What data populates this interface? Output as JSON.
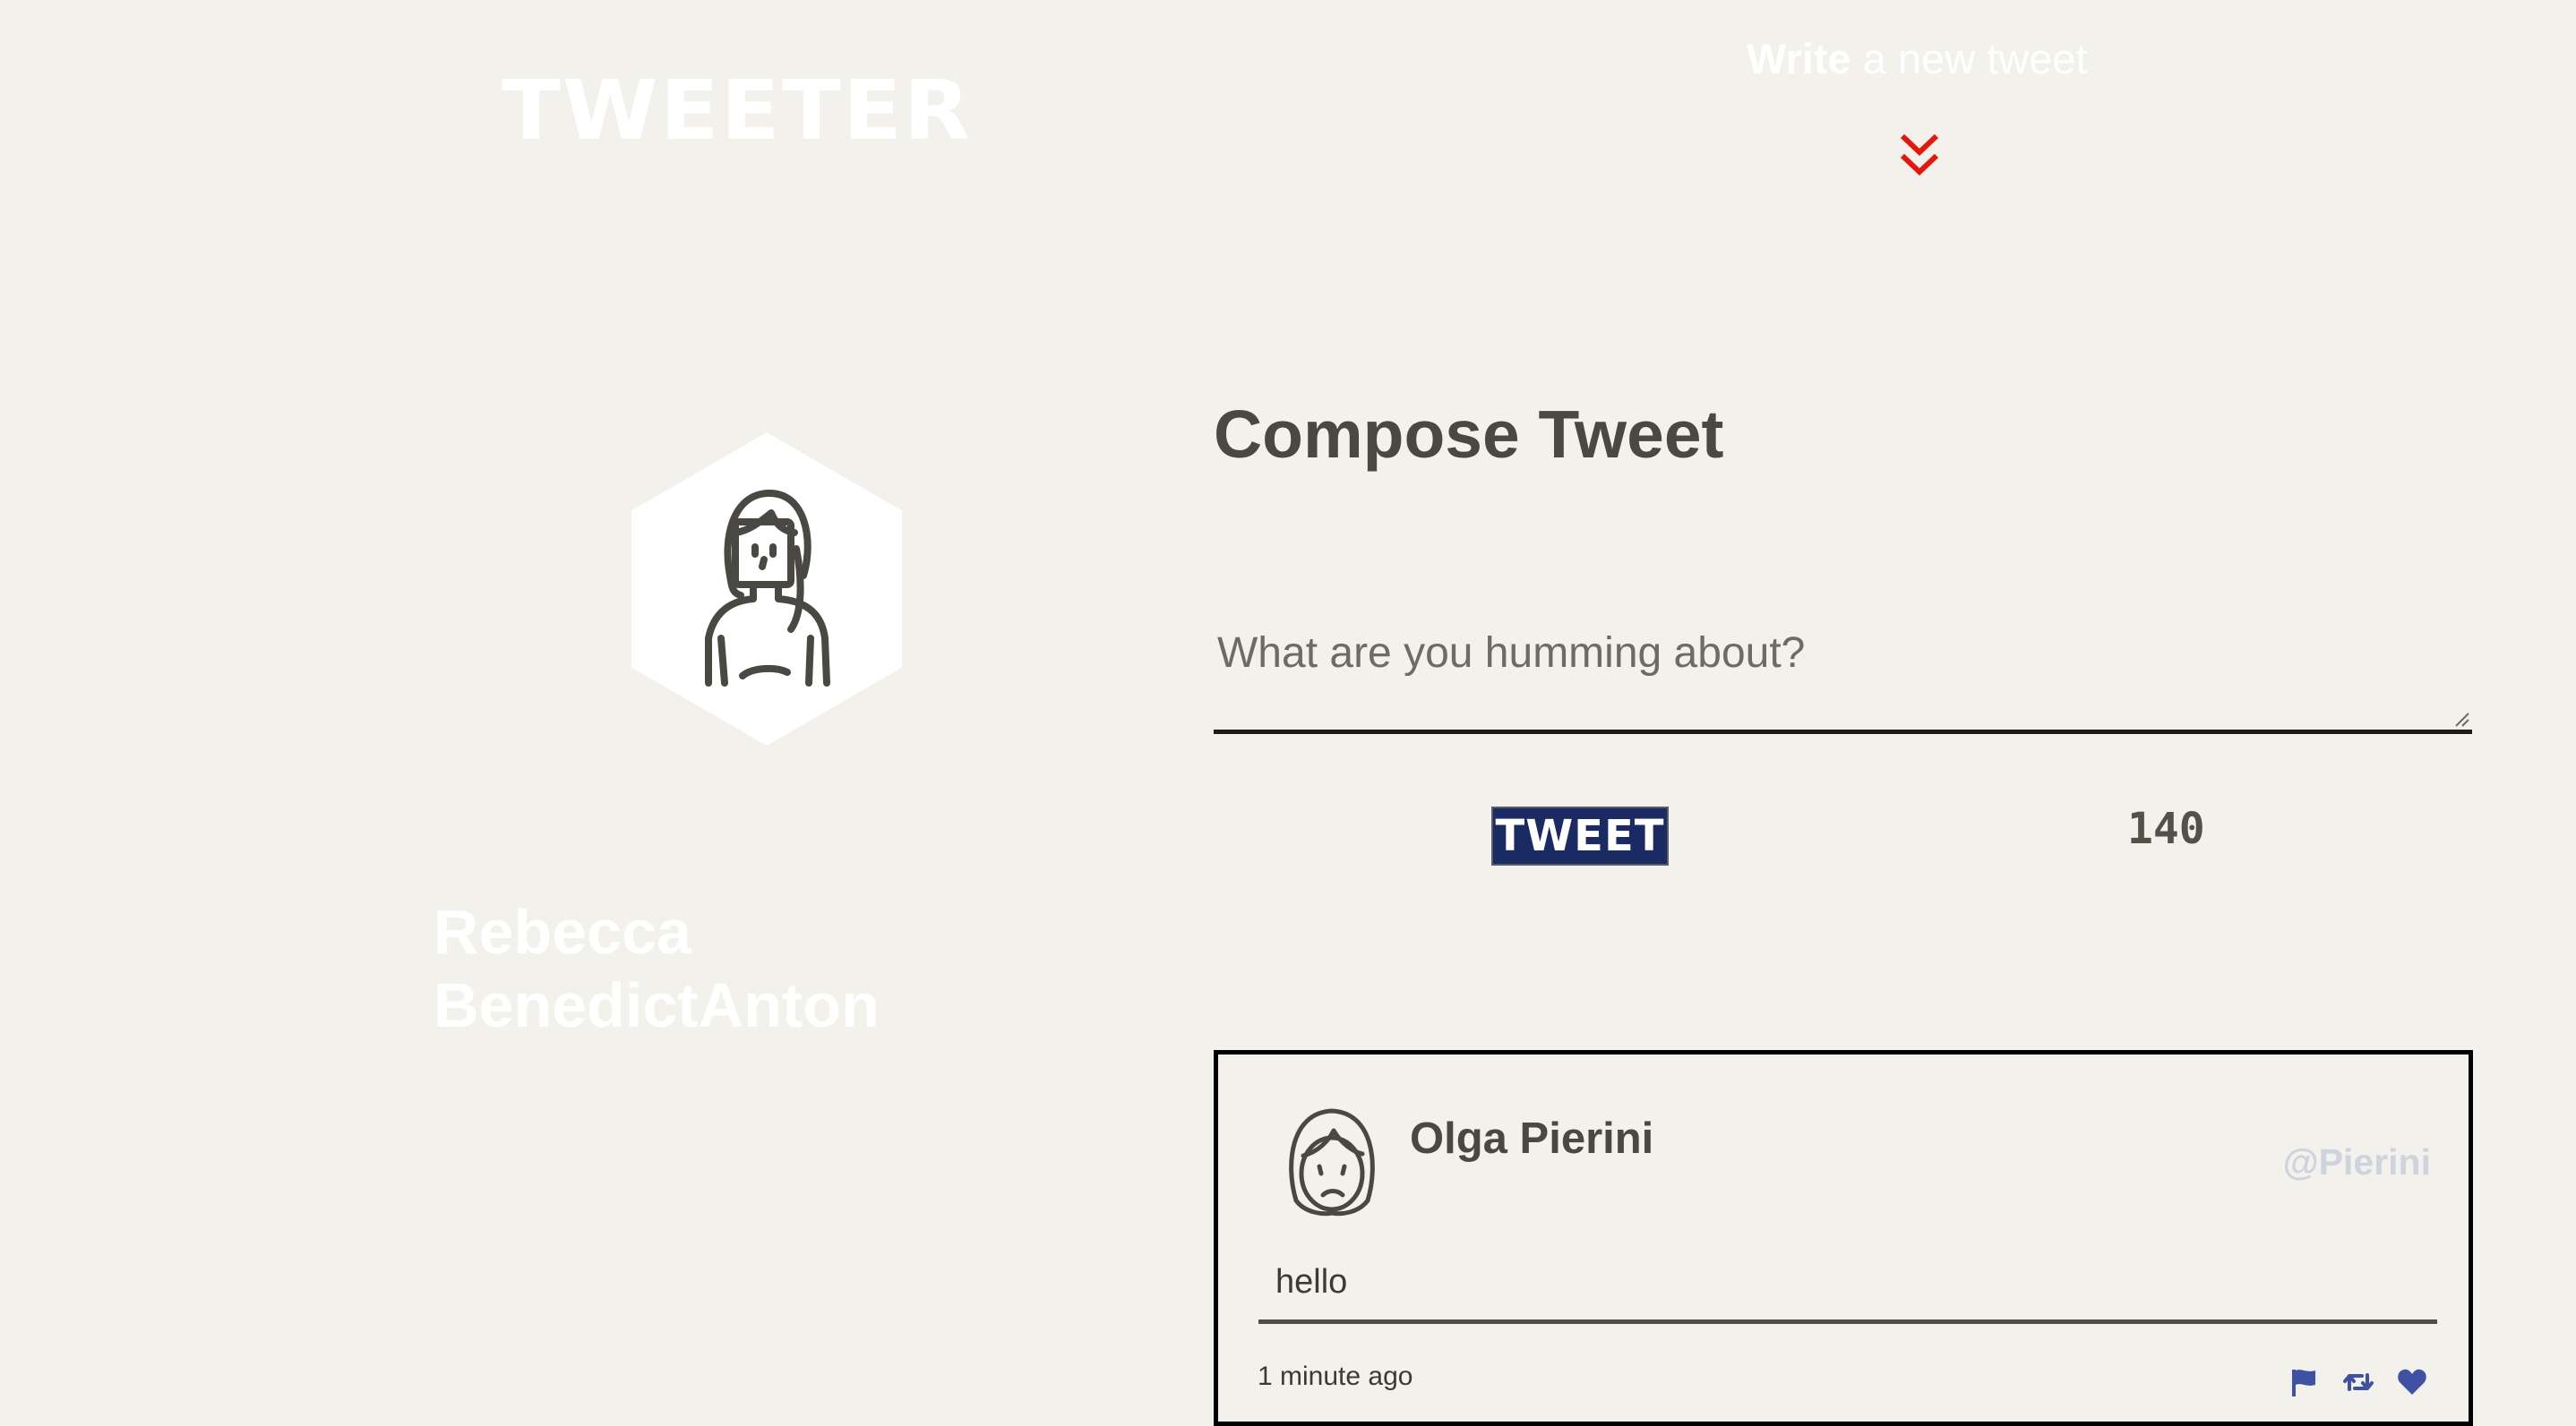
{
  "header": {
    "logo": "TWEETER",
    "write_bold": "Write",
    "write_rest": " a new tweet",
    "chevron_icon": "double-chevron-down-icon",
    "chevron_color": "#e3170a"
  },
  "profile": {
    "avatar_icon": "woman-avatar-icon",
    "name": "Rebecca BenedictAnton"
  },
  "compose": {
    "title": "Compose Tweet",
    "placeholder": "What are you humming about?",
    "value": "",
    "submit_label": "TWEET",
    "counter": "140"
  },
  "tweets": [
    {
      "avatar_icon": "sad-face-avatar-icon",
      "author": "Olga Pierini",
      "handle": "@Pierini",
      "text": "hello",
      "timestamp": "1 minute ago",
      "actions": [
        "flag-icon",
        "retweet-icon",
        "heart-icon"
      ]
    }
  ],
  "colors": {
    "background": "#f2f1ec",
    "button": "#1a2a62",
    "action_icons": "#3f51a3",
    "handle": "#cfd3de"
  }
}
